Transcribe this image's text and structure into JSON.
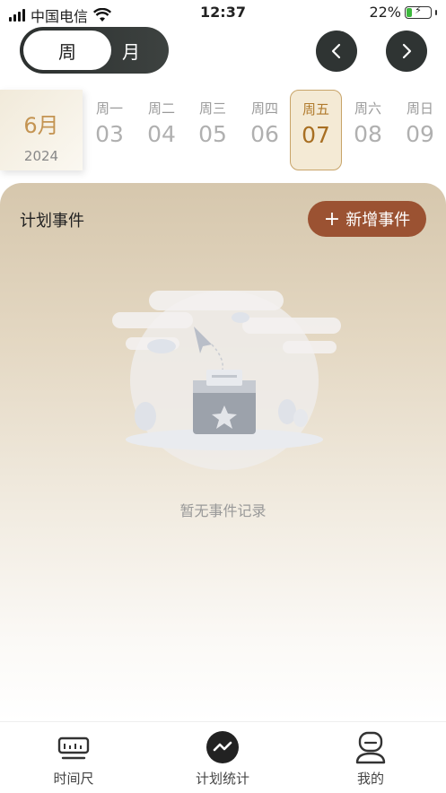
{
  "status_bar": {
    "carrier": "中国电信",
    "time": "12:37",
    "battery": "22%",
    "battery_level": 0.22
  },
  "view_toggle": {
    "week": "周",
    "month": "月",
    "selected": "week"
  },
  "calendar": {
    "month": "6月",
    "year": "2024",
    "days": [
      {
        "weekday": "周一",
        "date": "03"
      },
      {
        "weekday": "周二",
        "date": "04"
      },
      {
        "weekday": "周三",
        "date": "05"
      },
      {
        "weekday": "周四",
        "date": "06"
      },
      {
        "weekday": "周五",
        "date": "07"
      },
      {
        "weekday": "周六",
        "date": "08"
      },
      {
        "weekday": "周日",
        "date": "09"
      }
    ],
    "selected_day": "07"
  },
  "panel": {
    "title": "计划事件",
    "add_button": "新增事件",
    "empty_text": "暂无事件记录"
  },
  "tabs": [
    {
      "label": "时间尺",
      "icon": "ruler-icon"
    },
    {
      "label": "计划统计",
      "icon": "trend-icon",
      "active": true
    },
    {
      "label": "我的",
      "icon": "user-icon"
    }
  ],
  "colors": {
    "accent": "#9b5232",
    "gold": "#c49452",
    "dark": "#2f3433"
  }
}
